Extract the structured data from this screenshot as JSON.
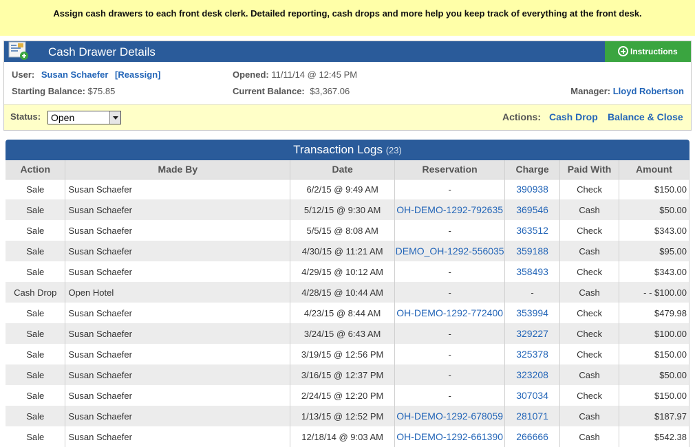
{
  "banner": "Assign cash drawers to each front desk clerk. Detailed reporting, cash drops and more help you keep track of everything at the front desk.",
  "drawer": {
    "title": "Cash Drawer Details",
    "instructions_label": "Instructions",
    "user_label": "User:",
    "user_name": "Susan Schaefer",
    "reassign": "[Reassign]",
    "starting_balance_label": "Starting Balance:",
    "starting_balance": "$75.85",
    "opened_label": "Opened:",
    "opened": "11/11/14 @ 12:45 PM",
    "current_balance_label": "Current Balance:",
    "current_balance": "$3,367.06",
    "manager_label": "Manager:",
    "manager_name": "Lloyd Robertson",
    "status_label": "Status:",
    "status_value": "Open",
    "actions_label": "Actions:",
    "action_cash_drop": "Cash Drop",
    "action_balance_close": "Balance & Close"
  },
  "logs": {
    "title": "Transaction Logs",
    "count": "(23)",
    "columns": [
      "Action",
      "Made By",
      "Date",
      "Reservation",
      "Charge",
      "Paid With",
      "Amount"
    ],
    "rows": [
      {
        "action": "Sale",
        "made_by": "Susan Schaefer",
        "date": "6/2/15 @ 9:49 AM",
        "reservation": "-",
        "charge": "390938",
        "paid_with": "Check",
        "amount": "$150.00"
      },
      {
        "action": "Sale",
        "made_by": "Susan Schaefer",
        "date": "5/12/15 @ 9:30 AM",
        "reservation": "OH-DEMO-1292-792635",
        "charge": "369546",
        "paid_with": "Cash",
        "amount": "$50.00"
      },
      {
        "action": "Sale",
        "made_by": "Susan Schaefer",
        "date": "5/5/15 @ 8:08 AM",
        "reservation": "-",
        "charge": "363512",
        "paid_with": "Check",
        "amount": "$343.00"
      },
      {
        "action": "Sale",
        "made_by": "Susan Schaefer",
        "date": "4/30/15 @ 11:21 AM",
        "reservation": "DEMO_OH-1292-556035",
        "charge": "359188",
        "paid_with": "Cash",
        "amount": "$95.00"
      },
      {
        "action": "Sale",
        "made_by": "Susan Schaefer",
        "date": "4/29/15 @ 10:12 AM",
        "reservation": "-",
        "charge": "358493",
        "paid_with": "Check",
        "amount": "$343.00"
      },
      {
        "action": "Cash Drop",
        "made_by": "Open Hotel",
        "date": "4/28/15 @ 10:44 AM",
        "reservation": "-",
        "charge": "-",
        "paid_with": "Cash",
        "amount": "- - $100.00"
      },
      {
        "action": "Sale",
        "made_by": "Susan Schaefer",
        "date": "4/23/15 @ 8:44 AM",
        "reservation": "OH-DEMO-1292-772400",
        "charge": "353994",
        "paid_with": "Check",
        "amount": "$479.98"
      },
      {
        "action": "Sale",
        "made_by": "Susan Schaefer",
        "date": "3/24/15 @ 6:43 AM",
        "reservation": "-",
        "charge": "329227",
        "paid_with": "Check",
        "amount": "$100.00"
      },
      {
        "action": "Sale",
        "made_by": "Susan Schaefer",
        "date": "3/19/15 @ 12:56 PM",
        "reservation": "-",
        "charge": "325378",
        "paid_with": "Check",
        "amount": "$150.00"
      },
      {
        "action": "Sale",
        "made_by": "Susan Schaefer",
        "date": "3/16/15 @ 12:37 PM",
        "reservation": "-",
        "charge": "323208",
        "paid_with": "Cash",
        "amount": "$50.00"
      },
      {
        "action": "Sale",
        "made_by": "Susan Schaefer",
        "date": "2/24/15 @ 12:20 PM",
        "reservation": "-",
        "charge": "307034",
        "paid_with": "Check",
        "amount": "$150.00"
      },
      {
        "action": "Sale",
        "made_by": "Susan Schaefer",
        "date": "1/13/15 @ 12:52 PM",
        "reservation": "OH-DEMO-1292-678059",
        "charge": "281071",
        "paid_with": "Cash",
        "amount": "$187.97"
      },
      {
        "action": "Sale",
        "made_by": "Susan Schaefer",
        "date": "12/18/14 @ 9:03 AM",
        "reservation": "OH-DEMO-1292-661390",
        "charge": "266666",
        "paid_with": "Cash",
        "amount": "$542.38"
      }
    ]
  }
}
